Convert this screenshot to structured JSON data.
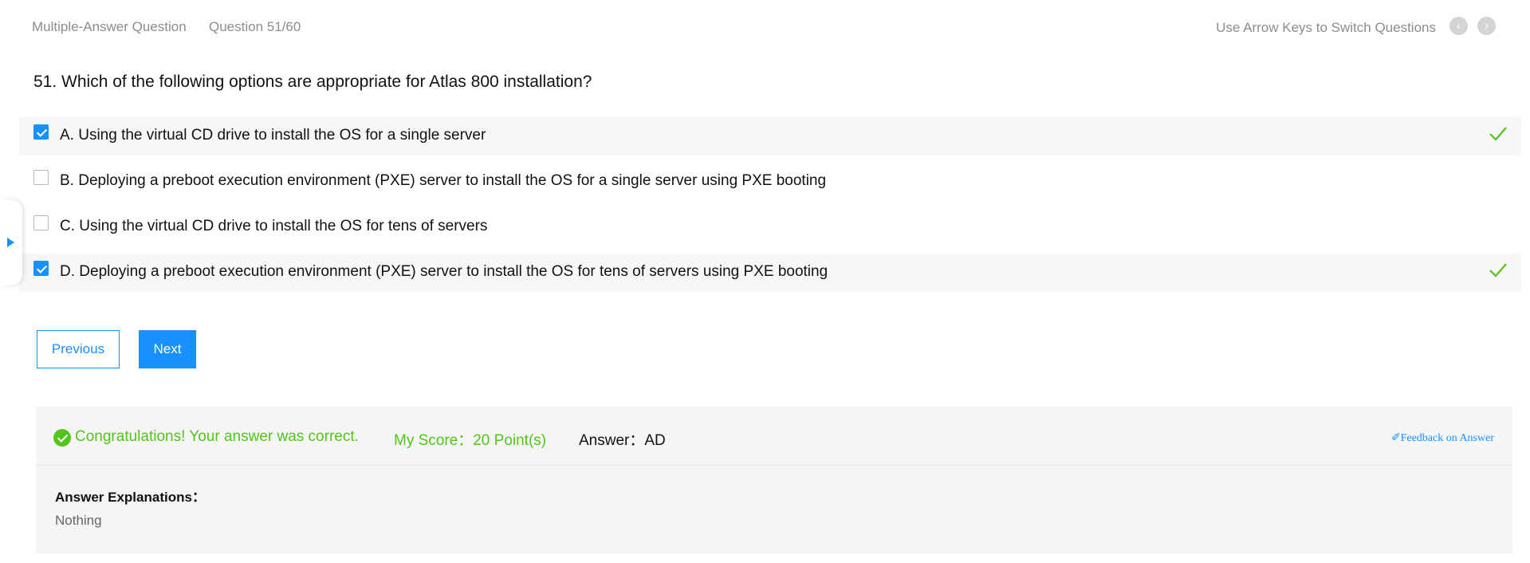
{
  "header": {
    "question_type": "Multiple-Answer Question",
    "question_number": "Question 51/60",
    "hint": "Use Arrow Keys to Switch Questions",
    "prev_icon": "chevron-left-icon",
    "next_icon": "chevron-right-icon"
  },
  "question": {
    "text": "51. Which of the following options are appropriate for Atlas 800 installation?"
  },
  "options": [
    {
      "label": "A. Using the virtual CD drive to install the OS for a single server",
      "checked": true,
      "correct": true
    },
    {
      "label": "B. Deploying a preboot execution environment (PXE) server to install the OS for a single server using PXE booting",
      "checked": false,
      "correct": false
    },
    {
      "label": "C. Using the virtual CD drive to install the OS for tens of servers",
      "checked": false,
      "correct": false
    },
    {
      "label": "D. Deploying a preboot execution environment (PXE) server to install the OS for tens of servers using PXE booting",
      "checked": true,
      "correct": true
    }
  ],
  "buttons": {
    "previous": "Previous",
    "next": "Next"
  },
  "result": {
    "message": "Congratulations! Your answer was correct.",
    "score": "My Score：20 Point(s)",
    "answer": "Answer：AD",
    "feedback": "✐Feedback on Answer",
    "explanation_title": "Answer Explanations：",
    "explanation_text": "Nothing"
  },
  "colors": {
    "accent": "#1890ff",
    "success": "#52c41a",
    "muted": "#8c8c8c"
  }
}
